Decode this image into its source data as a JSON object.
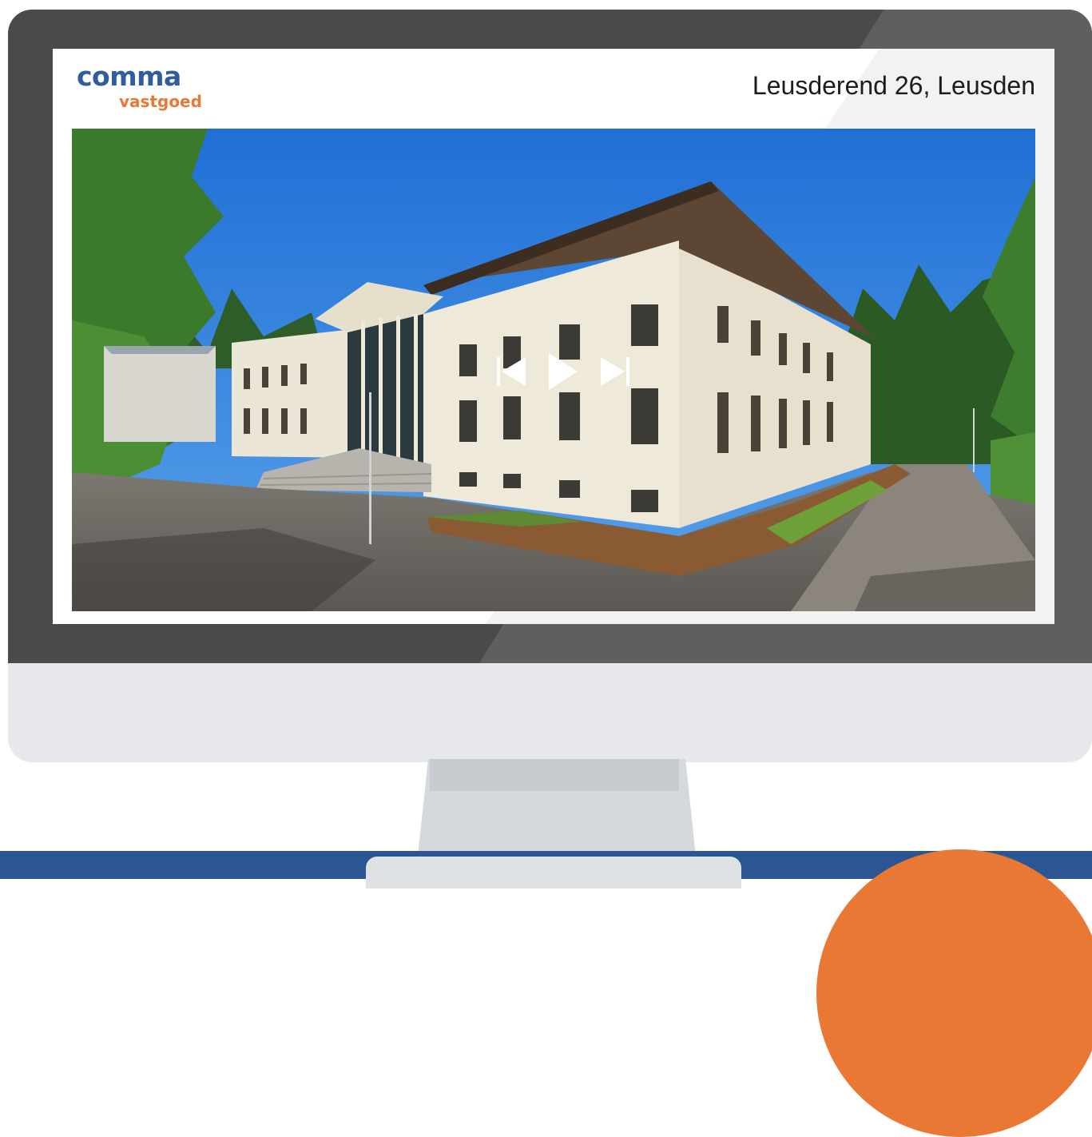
{
  "logo": {
    "brand": "comma",
    "sub": "vastgoed"
  },
  "property": {
    "address": "Leusderend 26, Leusden"
  },
  "player": {
    "controls": [
      "skip-back-icon",
      "play-icon",
      "skip-forward-icon"
    ]
  },
  "colors": {
    "brand_blue": "#2f5d9e",
    "brand_orange": "#e97834",
    "footer_blue": "#2c5593",
    "bezel": "#4a4a4a"
  }
}
